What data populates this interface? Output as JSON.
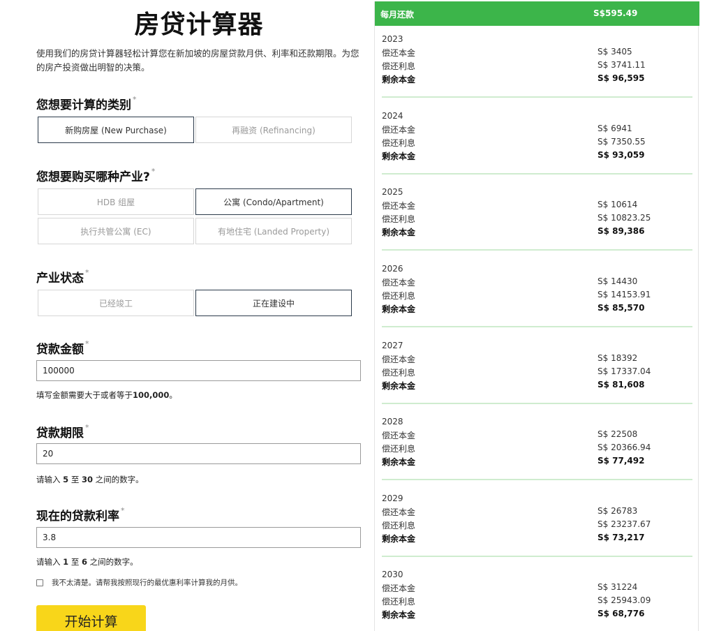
{
  "form": {
    "title": "房贷计算器",
    "intro": "使用我们的房贷计算器轻松计算您在新加坡的房屋贷款月供、利率和还款期限。为您的房产投资做出明智的决策。",
    "required_mark": "*",
    "category": {
      "label": "您想要计算的类别",
      "options": [
        "新购房屋 (New Purchase)",
        "再融资 (Refinancing)"
      ],
      "selected": "新购房屋 (New Purchase)"
    },
    "property_type": {
      "label": "您想要购买哪种产业?",
      "options": [
        "HDB 组屋",
        "公寓 (Condo/Apartment)",
        "执行共管公寓 (EC)",
        "有地住宅 (Landed Property)"
      ],
      "selected": "公寓 (Condo/Apartment)"
    },
    "property_status": {
      "label": "产业状态",
      "options": [
        "已经竣工",
        "正在建设中"
      ],
      "selected": "正在建设中"
    },
    "loan_amount": {
      "label": "贷款金额",
      "value": "100000",
      "hint_prefix": "填写金额需要大于或者等于",
      "hint_bold": "100,000",
      "hint_suffix": "。"
    },
    "loan_tenure": {
      "label": "贷款期限",
      "value": "20",
      "hint_prefix": "请输入",
      "hint_min": "5",
      "hint_mid": "至",
      "hint_max": "30",
      "hint_suffix": "之间的数字。"
    },
    "interest_rate": {
      "label": "现在的贷款利率",
      "value": "3.8",
      "hint_prefix": "请输入",
      "hint_min": "1",
      "hint_mid": "至",
      "hint_max": "6",
      "hint_suffix": "之间的数字。"
    },
    "checkbox_label": "我不太清楚。请帮我按照现行的最优惠利率计算我的月供。",
    "submit_label": "开始计算"
  },
  "schedule": {
    "monthly_label": "每月还款",
    "monthly_value": "S$595.49",
    "principal_label": "偿还本金",
    "interest_label": "偿还利息",
    "remaining_label": "剩余本金",
    "years": [
      {
        "year": "2023",
        "principal": "S$ 3405",
        "interest": "S$ 3741.11",
        "remaining": "S$ 96,595"
      },
      {
        "year": "2024",
        "principal": "S$ 6941",
        "interest": "S$ 7350.55",
        "remaining": "S$ 93,059"
      },
      {
        "year": "2025",
        "principal": "S$ 10614",
        "interest": "S$ 10823.25",
        "remaining": "S$ 89,386"
      },
      {
        "year": "2026",
        "principal": "S$ 14430",
        "interest": "S$ 14153.91",
        "remaining": "S$ 85,570"
      },
      {
        "year": "2027",
        "principal": "S$ 18392",
        "interest": "S$ 17337.04",
        "remaining": "S$ 81,608"
      },
      {
        "year": "2028",
        "principal": "S$ 22508",
        "interest": "S$ 20366.94",
        "remaining": "S$ 77,492"
      },
      {
        "year": "2029",
        "principal": "S$ 26783",
        "interest": "S$ 23237.67",
        "remaining": "S$ 73,217"
      },
      {
        "year": "2030",
        "principal": "S$ 31224",
        "interest": "S$ 25943.09",
        "remaining": "S$ 68,776"
      }
    ]
  },
  "colors": {
    "accent_green": "#3cb54a",
    "button_yellow": "#f8d61a",
    "selected_border": "#2b3a4a"
  }
}
